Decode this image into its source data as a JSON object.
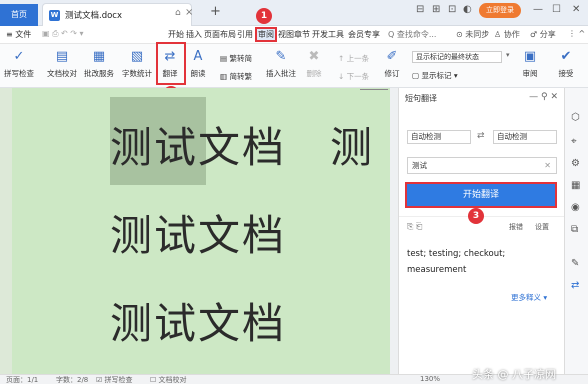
{
  "tabs": {
    "home": "首页",
    "doc": "测试文档.docx",
    "plus": "+"
  },
  "window": {
    "login": "立即登录",
    "icons": [
      "⊟",
      "⊞",
      "⊡",
      "—",
      "☐",
      "✕"
    ]
  },
  "menu": {
    "file": "≡ 文件",
    "items": [
      "开始",
      "插入",
      "页面布局",
      "引用",
      "审阅",
      "视图",
      "章节",
      "开发工具",
      "会员专享"
    ],
    "search": "Q 查找命令...",
    "right": [
      "⊙ 未同步",
      "♙ 协作",
      "♂ 分享"
    ]
  },
  "ribbon": {
    "spellcheck": "拼写检查",
    "doc_proof": "文档校对",
    "review_service": "批改服务",
    "word_count": "字数统计",
    "translate": "翻译",
    "read_aloud": "朗读",
    "simp_to_trad": "繁转简",
    "trad_to_simp": "简转繁",
    "insert_comment": "插入批注",
    "delete": "删除",
    "prev": "上一条",
    "next": "下一条",
    "track_changes": "修订",
    "display_state": "显示标记的最终状态",
    "show_markup": "显示标记",
    "review": "审阅",
    "accept": "接受"
  },
  "badges": [
    "1",
    "2",
    "3"
  ],
  "document": {
    "lines": [
      "测试文档　测",
      "测试文档",
      "测试文档"
    ]
  },
  "panel": {
    "title": "短句翻译",
    "source_lang": "自动检测",
    "target_lang": "自动检测",
    "source_text": "测试",
    "translate_button": "开始翻译",
    "save": "报错",
    "settings": "设置",
    "result": "test; testing; checkout; measurement",
    "more": "更多释义"
  },
  "status": {
    "page": "页面：1/1",
    "words": "字数：2/8",
    "spell": "拼写检查",
    "proof": "文档校对",
    "zoom": "130%"
  },
  "watermark": "头条 @ 八子凉网"
}
